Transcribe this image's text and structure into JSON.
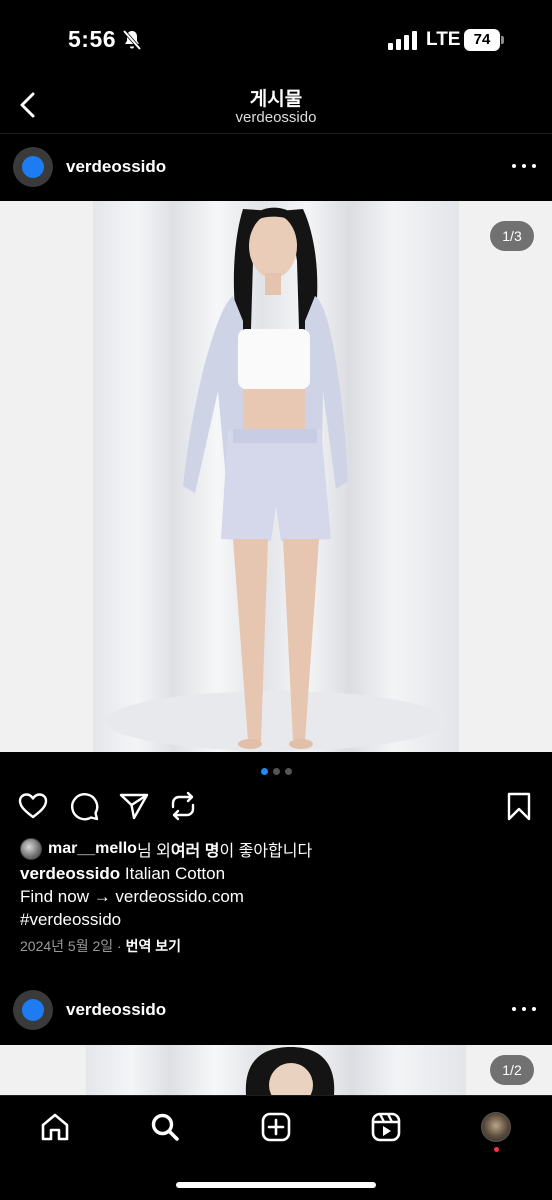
{
  "status_bar": {
    "time": "5:56",
    "network": "LTE",
    "battery": "74"
  },
  "header": {
    "title": "게시물",
    "subtitle": "verdeossido"
  },
  "post1": {
    "username": "verdeossido",
    "counter": "1/3",
    "carousel": {
      "total": 3,
      "active_index": 0
    },
    "likes": {
      "user": "mar__mello",
      "text_after_user": "님 외 ",
      "others": "여러 명",
      "suffix": "이 좋아합니다"
    },
    "caption": {
      "username": "verdeossido",
      "text": " Italian Cotton",
      "line2": "Find now → verdeossido.com",
      "line3": "#verdeossido"
    },
    "date": "2024년 5월 2일",
    "separator": " · ",
    "translate": "번역 보기"
  },
  "post2": {
    "username": "verdeossido",
    "counter": "1/2"
  },
  "icons": {
    "back": "chevron-left-icon",
    "bell_off": "bell-slash-icon",
    "like": "heart-icon",
    "comment": "comment-icon",
    "share": "paper-plane-icon",
    "repost": "repost-icon",
    "save": "bookmark-icon",
    "home": "home-icon",
    "search": "search-icon",
    "create": "plus-square-icon",
    "reels": "reels-icon"
  },
  "colors": {
    "background": "#000000",
    "accent": "#1d8cf8",
    "avatar_blue": "#1d7cf2",
    "notification": "#ff3040"
  }
}
